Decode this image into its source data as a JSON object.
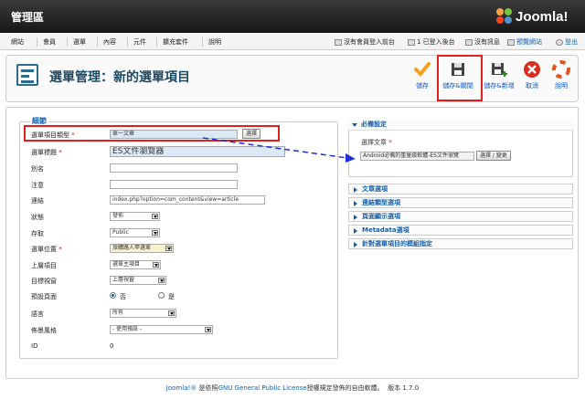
{
  "header": {
    "title": "管理區",
    "brand": "Joomla!"
  },
  "menu": {
    "items": [
      "網站",
      "會員",
      "選單",
      "內容",
      "元件",
      "擴充套件",
      "說明"
    ]
  },
  "status": {
    "preview": "沒有會員登入前台",
    "logged_in": "1 已登入後台",
    "messages": "沒有訊息",
    "view_site": "預覽網站",
    "logout": "登出"
  },
  "page": {
    "title": "選單管理：新的選單項目"
  },
  "toolbar": {
    "save": "儲存",
    "save_close": "儲存&關閉",
    "save_new": "儲存&新增",
    "cancel": "取消",
    "help": "說明"
  },
  "details": {
    "legend": "細節",
    "menu_type_label": "選單項目類型",
    "menu_type_value": "單一文章",
    "select_button": "選擇",
    "title_label": "選單標題",
    "title_value": "ES文件瀏覽器",
    "alias_label": "別名",
    "alias_value": "",
    "note_label": "注意",
    "note_value": "",
    "link_label": "連結",
    "link_value": "index.php?option=com_content&view=article",
    "state_label": "狀態",
    "state_value": "發佈",
    "access_label": "存取",
    "access_value": "Public",
    "menu_location_label": "選單位置",
    "menu_location_value": "旅購路人甲選單",
    "parent_label": "上層項目",
    "parent_value": "選單主項目",
    "target_label": "目標視窗",
    "target_value": "上層視窗",
    "home_label": "預設頁面",
    "home_no": "否",
    "home_yes": "是",
    "language_label": "語言",
    "language_value": "所有",
    "template_label": "佈景風格",
    "template_value": "- 使用預設 -",
    "id_label": "ID",
    "id_value": "0"
  },
  "required": {
    "title": "必備設定",
    "article_label": "選擇文章",
    "article_value": "Android必備的重量級軟體-ES文件瀏覽",
    "change_button": "選擇 / 變更"
  },
  "accordions": [
    "文章選項",
    "連結類型選項",
    "頁面顯示選項",
    "Metadata選項",
    "針對選單項目的模組指定"
  ],
  "footer": {
    "brand": "Joomla!®",
    "text1": " 是依照",
    "license": "GNU General Public License",
    "text2": "授權規定發佈的自由軟體。",
    "version": "版本 1.7.0"
  },
  "colors": {
    "highlight_red": "#e0201e",
    "arrow_blue": "#1e2fd6",
    "title_blue": "#1b4965",
    "link_blue": "#145ea8"
  }
}
